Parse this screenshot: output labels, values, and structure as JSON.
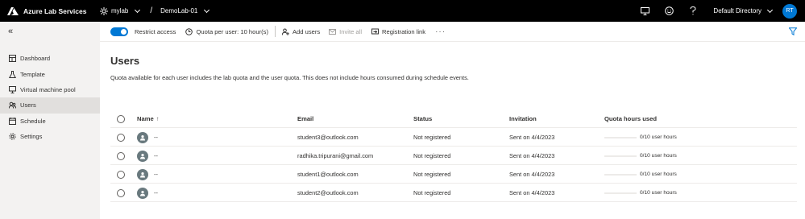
{
  "topbar": {
    "app_title": "Azure Lab Services",
    "lab_plan": "mylab",
    "separator": "/",
    "lab": "DemoLab-01",
    "directory": "Default Directory",
    "user_initials": "RT"
  },
  "sidebar": {
    "items": [
      {
        "label": "Dashboard",
        "icon": "dashboard-icon",
        "active": false
      },
      {
        "label": "Template",
        "icon": "flask-icon",
        "active": false
      },
      {
        "label": "Virtual machine pool",
        "icon": "vm-icon",
        "active": false
      },
      {
        "label": "Users",
        "icon": "users-icon",
        "active": true
      },
      {
        "label": "Schedule",
        "icon": "calendar-icon",
        "active": false
      },
      {
        "label": "Settings",
        "icon": "gear-icon",
        "active": false
      }
    ]
  },
  "commandbar": {
    "restrict_access": "Restrict access",
    "restrict_access_on": true,
    "quota": "Quota per user: 10 hour(s)",
    "add_users": "Add users",
    "invite_all": "Invite all",
    "registration_link": "Registration link",
    "more": "···"
  },
  "main": {
    "title": "Users",
    "description": "Quota available for each user includes the lab quota and the user quota. This does not include hours consumed during schedule events."
  },
  "table": {
    "headers": {
      "name": "Name",
      "sort_arrow": "↑",
      "email": "Email",
      "status": "Status",
      "invitation": "Invitation",
      "quota": "Quota hours used"
    },
    "rows": [
      {
        "name": "--",
        "email": "student3@outlook.com",
        "status": "Not registered",
        "invitation": "Sent on 4/4/2023",
        "quota": "0/10 user hours",
        "quota_fraction": 0
      },
      {
        "name": "--",
        "email": "radhika.tripurani@gmail.com",
        "status": "Not registered",
        "invitation": "Sent on 4/4/2023",
        "quota": "0/10 user hours",
        "quota_fraction": 0
      },
      {
        "name": "--",
        "email": "student1@outlook.com",
        "status": "Not registered",
        "invitation": "Sent on 4/4/2023",
        "quota": "0/10 user hours",
        "quota_fraction": 0
      },
      {
        "name": "--",
        "email": "student2@outlook.com",
        "status": "Not registered",
        "invitation": "Sent on 4/4/2023",
        "quota": "0/10 user hours",
        "quota_fraction": 0
      }
    ]
  },
  "colors": {
    "accent": "#0078d4",
    "topbar_bg": "#000000",
    "sidebar_bg": "#f3f2f1",
    "avatar_bg": "#69797e"
  }
}
